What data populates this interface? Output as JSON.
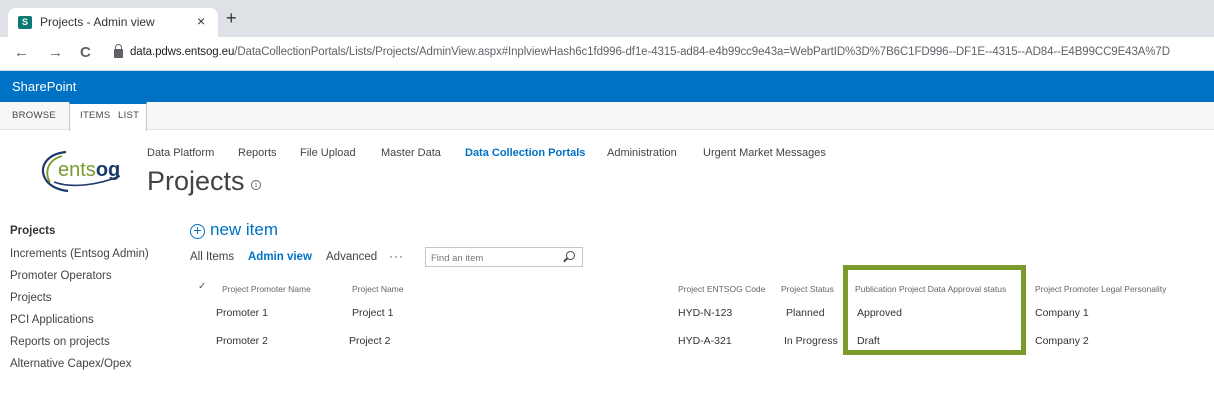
{
  "browser": {
    "tab_title": "Projects - Admin view",
    "tab_close": "×",
    "new_tab": "+",
    "back": "←",
    "forward": "→",
    "reload": "C",
    "url_host": "data.pdws.entsog.eu",
    "url_path": "/DataCollectionPortals/Lists/Projects/AdminView.aspx#InplviewHash6c1fd996-df1e-4315-ad84-e4b99cc9e43a=WebPartID%3D%7B6C1FD996--DF1E--4315--AD84--E4B99CC9E43A%7D"
  },
  "suite": {
    "title": "SharePoint",
    "color": "#0072c6"
  },
  "ribbon": {
    "tabs": [
      "BROWSE",
      "ITEMS",
      "LIST"
    ]
  },
  "logo": {
    "text": "entsog"
  },
  "topnav": {
    "items": [
      "Data Platform",
      "Reports",
      "File Upload",
      "Master Data",
      "Data Collection Portals",
      "Administration",
      "Urgent Market Messages"
    ],
    "active": "Data Collection Portals"
  },
  "page": {
    "title": "Projects",
    "info": "i"
  },
  "leftnav": {
    "items": [
      "Projects",
      "Increments (Entsog Admin)",
      "Promoter Operators",
      "Projects",
      "PCI Applications",
      "Reports on projects",
      "Alternative Capex/Opex"
    ]
  },
  "list": {
    "new_item": "new item",
    "plus": "+",
    "views": [
      "All Items",
      "Admin view",
      "Advanced"
    ],
    "more": "···",
    "search_placeholder": "Find an item",
    "check": "✓",
    "columns": [
      "Project Promoter Name",
      "Project Name",
      "Project ENTSOG Code",
      "Project Status",
      "Publication Project Data Approval status",
      "Project Promoter Legal Personality"
    ],
    "rows": [
      [
        "Promoter 1",
        "Project 1",
        "HYD-N-123",
        "Planned",
        "Approved",
        "Company 1"
      ],
      [
        "Promoter 2",
        "Project 2",
        "HYD-A-321",
        "In Progress",
        "Draft",
        "Company 2"
      ]
    ]
  },
  "highlight_color": "#7a9a2c"
}
